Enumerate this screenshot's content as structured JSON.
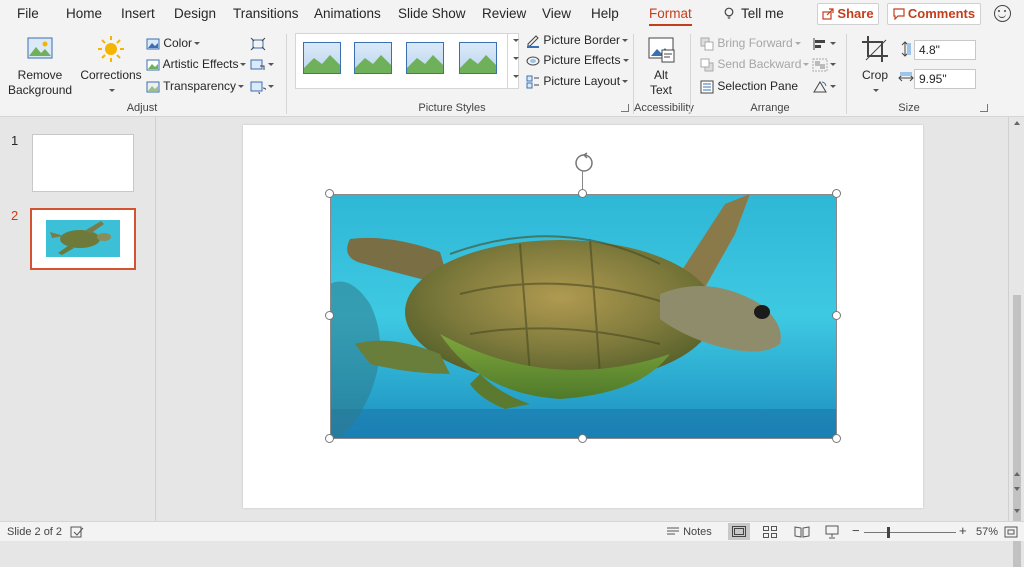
{
  "menu": {
    "items": [
      {
        "label": "File"
      },
      {
        "label": "Home"
      },
      {
        "label": "Insert"
      },
      {
        "label": "Design"
      },
      {
        "label": "Transitions"
      },
      {
        "label": "Animations"
      },
      {
        "label": "Slide Show"
      },
      {
        "label": "Review"
      },
      {
        "label": "View"
      },
      {
        "label": "Help"
      },
      {
        "label": "Format"
      }
    ],
    "active_tab": "Format",
    "tell_me": "Tell me",
    "share": "Share",
    "comments": "Comments"
  },
  "ribbon": {
    "adjust": {
      "remove_background": "Remove\nBackground",
      "corrections": "Corrections",
      "color": "Color",
      "artistic_effects": "Artistic Effects",
      "transparency": "Transparency",
      "group_label": "Adjust"
    },
    "picture_styles": {
      "picture_border": "Picture Border",
      "picture_effects": "Picture Effects",
      "picture_layout": "Picture Layout",
      "group_label": "Picture Styles"
    },
    "accessibility": {
      "alt_text": "Alt\nText",
      "group_label": "Accessibility"
    },
    "arrange": {
      "bring_forward": "Bring Forward",
      "send_backward": "Send Backward",
      "selection_pane": "Selection Pane",
      "group_label": "Arrange"
    },
    "size": {
      "crop": "Crop",
      "height": "4.8\"",
      "width": "9.95\"",
      "group_label": "Size"
    }
  },
  "slides_panel": {
    "slides": [
      {
        "number": "1"
      },
      {
        "number": "2"
      }
    ],
    "active_slide": 2
  },
  "statusbar": {
    "slide_info": "Slide 2 of 2",
    "notes": "Notes",
    "zoom": "57%"
  },
  "colors": {
    "accent": "#c43e1c",
    "ribbon_bg": "#f3f3f3",
    "canvas_bg": "#e6e6e6"
  }
}
